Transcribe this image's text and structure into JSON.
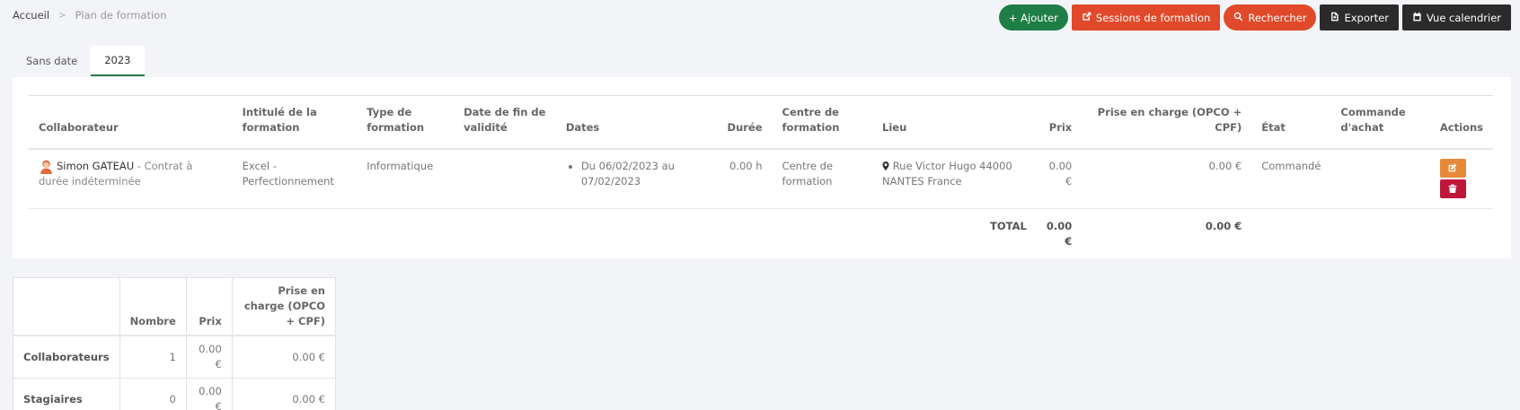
{
  "breadcrumb": {
    "home": "Accueil",
    "current": "Plan de formation"
  },
  "toolbar": {
    "add": "+ Ajouter",
    "sessions": "Sessions de formation",
    "search": "Rechercher",
    "export": "Exporter",
    "calendar": "Vue calendrier"
  },
  "colors": {
    "green": "#1e7e45",
    "orange": "#e04a2a",
    "dark": "#2b2b2b",
    "edit": "#e8893a",
    "delete": "#c0163a"
  },
  "tabs": [
    {
      "label": "Sans date",
      "active": false
    },
    {
      "label": "2023",
      "active": true
    }
  ],
  "table": {
    "headers": {
      "collaborateur": "Collaborateur",
      "intitule": "Intitulé de la formation",
      "type": "Type de formation",
      "date_fin": "Date de fin de validité",
      "dates": "Dates",
      "duree": "Durée",
      "centre": "Centre de formation",
      "lieu": "Lieu",
      "prix": "Prix",
      "prise": "Prise en charge (OPCO + CPF)",
      "etat": "État",
      "commande": "Commande d'achat",
      "actions": "Actions"
    },
    "rows": [
      {
        "name": "Simon GATEAU",
        "contract": " - Contrat à durée indéterminée",
        "intitule": "Excel - Perfectionnement",
        "type": "Informatique",
        "date_fin": "",
        "dates": "Du 06/02/2023 au 07/02/2023",
        "duree": "0.00 h",
        "centre": "Centre de formation",
        "lieu": "Rue Victor Hugo 44000 NANTES France",
        "prix": "0.00 €",
        "prise": "0.00 €",
        "etat": "Commandé",
        "commande": ""
      }
    ],
    "total": {
      "label": "TOTAL",
      "prix": "0.00 €",
      "prise": "0.00 €"
    }
  },
  "summary": {
    "headers": {
      "nombre": "Nombre",
      "prix": "Prix",
      "prise": "Prise en charge (OPCO + CPF)"
    },
    "rows": [
      {
        "label": "Collaborateurs",
        "nombre": "1",
        "prix": "0.00 €",
        "prise": "0.00 €"
      },
      {
        "label": "Stagiaires",
        "nombre": "0",
        "prix": "0.00 €",
        "prise": "0.00 €"
      }
    ]
  }
}
